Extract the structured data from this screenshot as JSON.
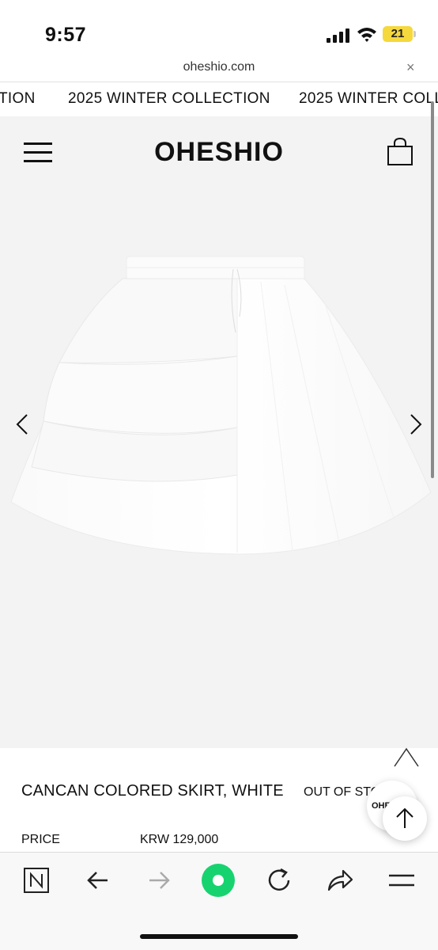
{
  "status_bar": {
    "time": "9:57",
    "battery": "21"
  },
  "browser": {
    "url": "oheshio.com",
    "close_glyph": "×"
  },
  "marquee": {
    "items": [
      "TION",
      "2025 WINTER COLLECTION",
      "2025 WINTER COLLE"
    ]
  },
  "site": {
    "logo": "OHESHIO"
  },
  "product": {
    "name": "CANCAN COLORED SKIRT, WHITE",
    "stock": "OUT OF STO",
    "price_label": "PRICE",
    "price_value": "KRW 129,000"
  },
  "floating": {
    "logo_text": "OHE"
  },
  "icons": {
    "menu": "hamburger-menu-icon",
    "cart": "shopping-bag-icon",
    "prev": "chevron-left-icon",
    "next": "chevron-right-icon",
    "collapse": "chevron-up-icon",
    "scroll_top": "arrow-up-icon"
  },
  "toolbar": {
    "items": [
      "naver-n-icon",
      "back-arrow-icon",
      "forward-arrow-icon",
      "green-home-icon",
      "reload-icon",
      "share-icon",
      "menu-lines-icon"
    ]
  },
  "colors": {
    "accent_green": "#17d36f",
    "battery_yellow": "#f5d83c",
    "page_bg": "#f3f3f3"
  }
}
